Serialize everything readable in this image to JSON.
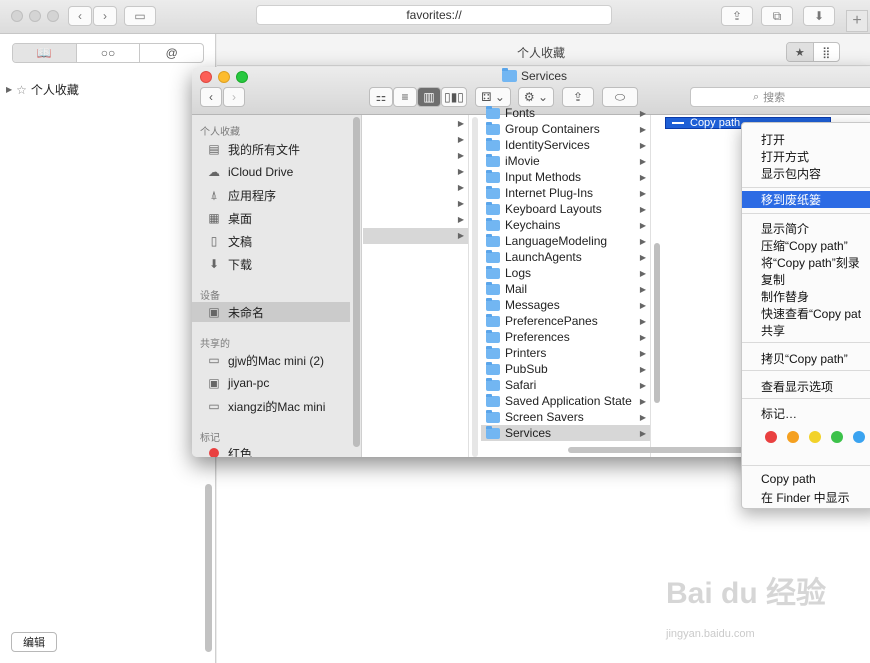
{
  "safari": {
    "url": "favorites://",
    "new_tab": "+",
    "sidebar_tabs": [
      "📖",
      "○○",
      "@"
    ],
    "sidebar_item": "个人收藏",
    "edit_button": "编辑",
    "main_title": "个人收藏",
    "view_star": "★",
    "view_grid": "⣿"
  },
  "finder": {
    "title": "Services",
    "search_placeholder": "搜索",
    "sidebar": {
      "favorites_header": "个人收藏",
      "favorites": [
        {
          "label": "我的所有文件",
          "icon": "all-files-icon",
          "glyph": "▤"
        },
        {
          "label": "iCloud Drive",
          "icon": "cloud-icon",
          "glyph": "☁"
        },
        {
          "label": "应用程序",
          "icon": "applications-icon",
          "glyph": "⍋"
        },
        {
          "label": "桌面",
          "icon": "desktop-icon",
          "glyph": "▦"
        },
        {
          "label": "文稿",
          "icon": "documents-icon",
          "glyph": "▯"
        },
        {
          "label": "下载",
          "icon": "downloads-icon",
          "glyph": "⬇"
        }
      ],
      "devices_header": "设备",
      "devices": [
        {
          "label": "未命名",
          "icon": "disk-icon",
          "glyph": "▣"
        }
      ],
      "shared_header": "共享的",
      "shared": [
        {
          "label": "gjw的Mac mini (2)",
          "icon": "computer-icon",
          "glyph": "▭"
        },
        {
          "label": "jiyan-pc",
          "icon": "computer-icon",
          "glyph": "▣"
        },
        {
          "label": "xiangzi的Mac mini",
          "icon": "computer-icon",
          "glyph": "▭"
        }
      ],
      "tags_header": "标记",
      "tags": [
        {
          "label": "红色",
          "color": "#e94040"
        }
      ]
    },
    "column2": [
      "Fonts",
      "Group Containers",
      "IdentityServices",
      "iMovie",
      "Input Methods",
      "Internet Plug-Ins",
      "Keyboard Layouts",
      "Keychains",
      "LanguageModeling",
      "LaunchAgents",
      "Logs",
      "Mail",
      "Messages",
      "PreferencePanes",
      "Preferences",
      "Printers",
      "PubSub",
      "Safari",
      "Saved Application State",
      "Screen Savers",
      "Services"
    ],
    "selected_item": "Copy path"
  },
  "context_menu": {
    "open": "打开",
    "open_with": "打开方式",
    "show_package": "显示包内容",
    "move_to_trash": "移到废纸篓",
    "get_info": "显示简介",
    "compress": "压缩“Copy path”",
    "burn": "将“Copy path”刻录",
    "duplicate": "复制",
    "make_alias": "制作替身",
    "quick_look": "快速查看“Copy pat",
    "share": "共享",
    "copy_item": "拷贝“Copy path”",
    "view_options": "查看显示选项",
    "tags": "标记…",
    "tag_colors": [
      "#e94040",
      "#f5a020",
      "#f2d22a",
      "#3cc24a",
      "#3aa3f0"
    ],
    "service_copy_path": "Copy path",
    "service_show_in_finder": "在 Finder 中显示"
  },
  "watermark": {
    "text": "Bai du 经验",
    "sub": "jingyan.baidu.com"
  }
}
